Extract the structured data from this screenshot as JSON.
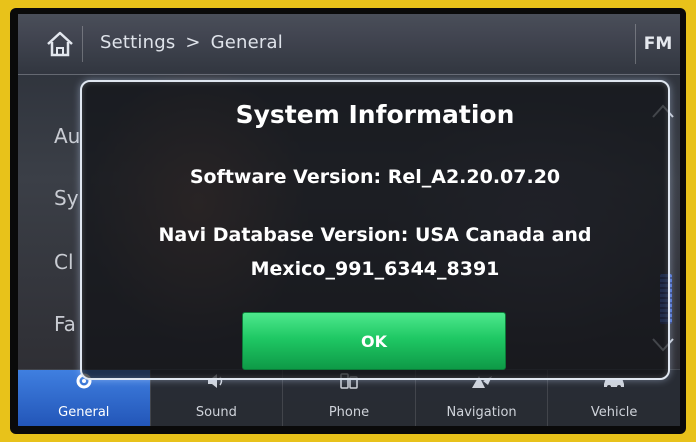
{
  "header": {
    "breadcrumb_settings": "Settings",
    "breadcrumb_sep": ">",
    "breadcrumb_general": "General",
    "source": "FM"
  },
  "background_list": [
    "Au",
    "Sy",
    "Cl",
    "Fa"
  ],
  "dialog": {
    "title": "System Information",
    "software_version": "Software Version: Rel_A2.20.07.20",
    "navi_line1": "Navi Database Version: USA Canada and",
    "navi_line2": "Mexico_991_6344_8391",
    "ok_label": "OK"
  },
  "bottom_nav": [
    {
      "label": "General",
      "icon": "gear-icon",
      "active": true
    },
    {
      "label": "Sound",
      "icon": "speaker-icon",
      "active": false
    },
    {
      "label": "Phone",
      "icon": "phone-icon",
      "active": false
    },
    {
      "label": "Navigation",
      "icon": "navigation-icon",
      "active": false
    },
    {
      "label": "Vehicle",
      "icon": "car-icon",
      "active": false
    }
  ],
  "colors": {
    "frame": "#e8c21a",
    "active_tab": "#2f6fd6",
    "ok_button": "#1fc864"
  }
}
